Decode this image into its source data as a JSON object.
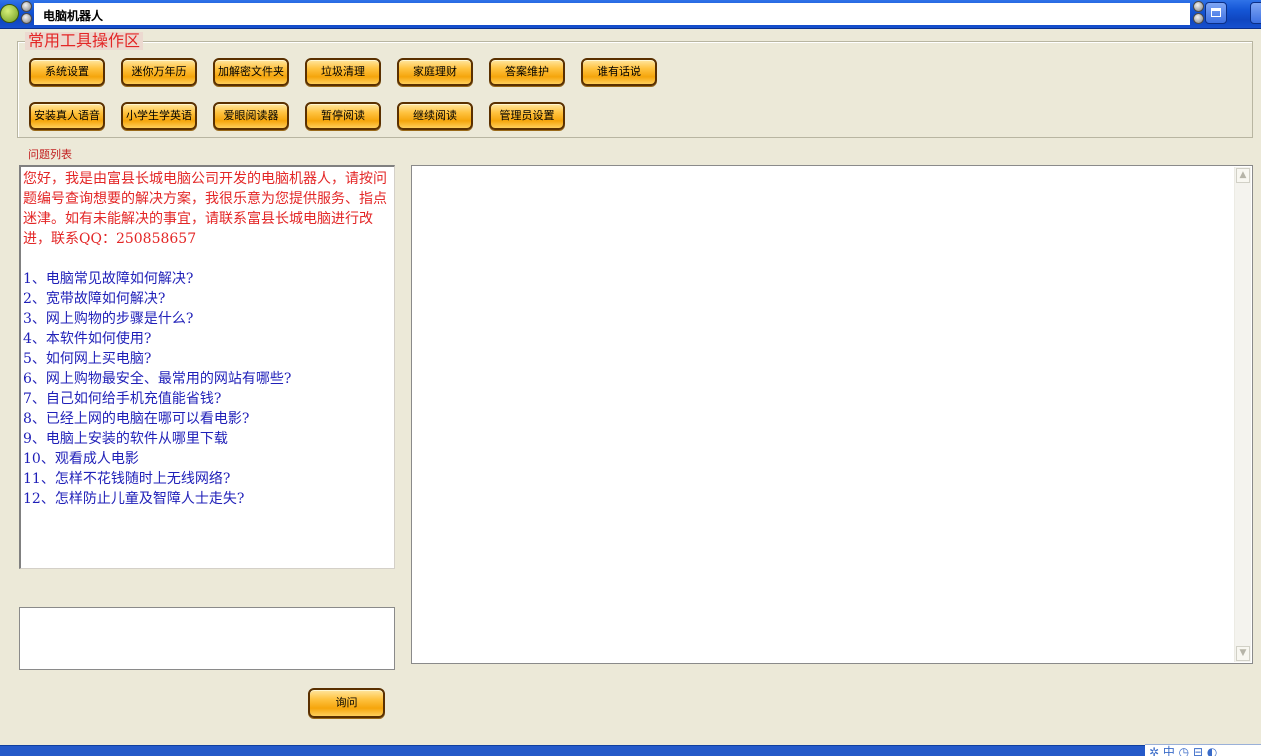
{
  "window": {
    "title": "电脑机器人"
  },
  "tools": {
    "legend": "常用工具操作区",
    "row1": [
      "系统设置",
      "迷你万年历",
      "加解密文件夹",
      "垃圾清理",
      "家庭理财",
      "答案维护",
      "谁有话说"
    ],
    "row2": [
      "安装真人语音",
      "小学生学英语",
      "爱眼阅读器",
      "暂停阅读",
      "继续阅读",
      "管理员设置"
    ]
  },
  "questions": {
    "label": "问题列表",
    "intro": "您好，我是由富县长城电脑公司开发的电脑机器人，请按问题编号查询想要的解决方案，我很乐意为您提供服务、指点迷津。如有未能解决的事宜，请联系富县长城电脑进行改进，联系QQ：250858657",
    "items": [
      "1、电脑常见故障如何解决?",
      "2、宽带故障如何解决?",
      "3、网上购物的步骤是什么?",
      "4、本软件如何使用?",
      "5、如何网上买电脑?",
      "6、网上购物最安全、最常用的网站有哪些?",
      "7、自己如何给手机充值能省钱?",
      "8、已经上网的电脑在哪可以看电影?",
      "9、电脑上安装的软件从哪里下载",
      "10、观看成人电影",
      "11、怎样不花钱随时上无线网络?",
      "12、怎样防止儿童及智障人士走失?"
    ]
  },
  "answer": {
    "text": ""
  },
  "query": {
    "value": "",
    "button_label": "询问"
  },
  "tray": {
    "text": "✲ 中 ◷ ⊟ ◐"
  },
  "colors": {
    "titlebar": "#1556d6",
    "button_orange": "#ffc341",
    "intro_red": "#e32626",
    "question_blue": "#1f1fb8",
    "window_bg": "#ece9d8"
  }
}
